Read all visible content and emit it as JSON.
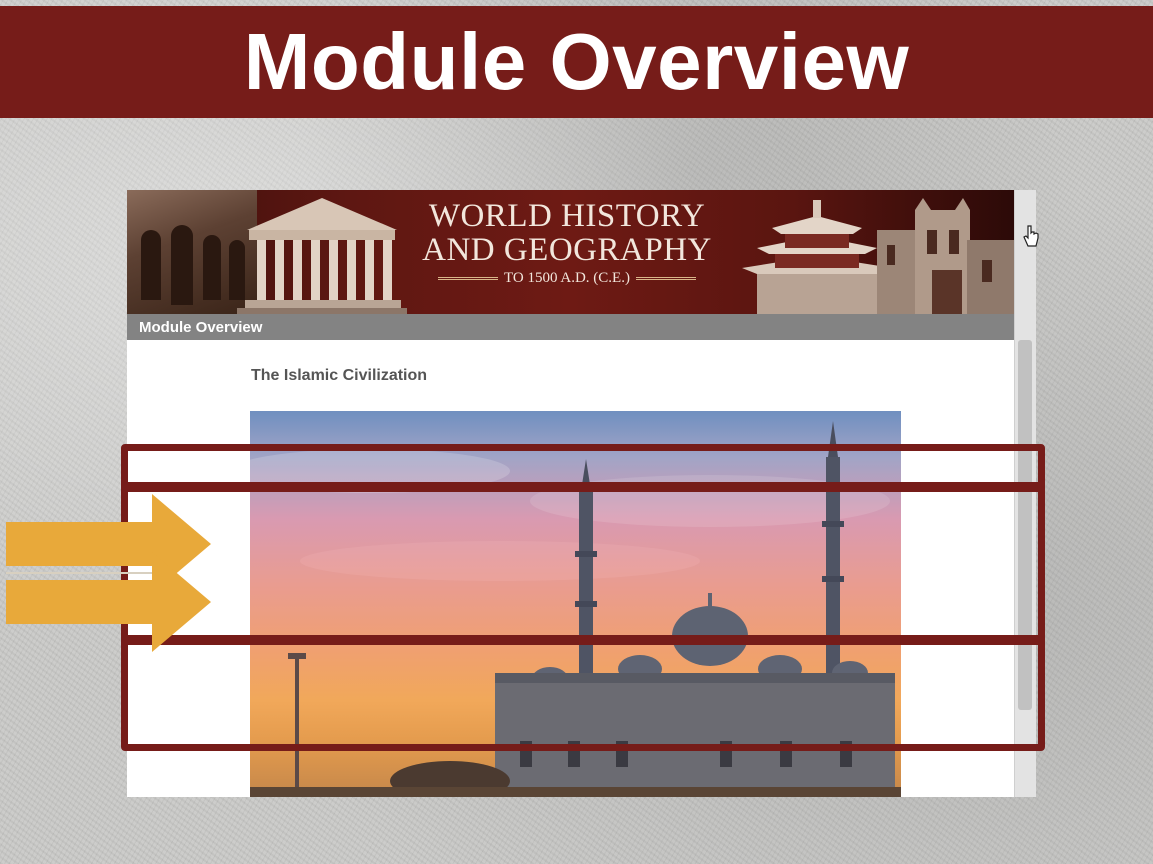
{
  "slide": {
    "title": "Module Overview"
  },
  "embedded_page": {
    "banner": {
      "line1": "WORLD HISTORY",
      "line2": "AND GEOGRAPHY",
      "line3": "TO 1500 A.D. (C.E.)"
    },
    "nav_label": "Module Overview",
    "section_title": "The Islamic Civilization"
  },
  "colors": {
    "accent": "#761c19",
    "arrow": "#e8a93a",
    "nav_bar": "#838383"
  },
  "icons": {
    "cursor": "hand-pointer-icon",
    "arrows": "right-arrow-icon"
  }
}
